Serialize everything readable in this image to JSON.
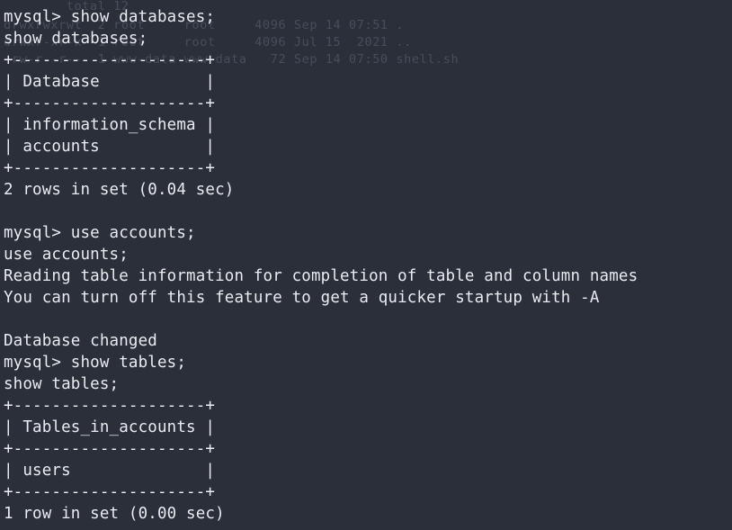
{
  "terminal": {
    "background_color": "#2b2f3a",
    "foreground_color": "#e9ebf1",
    "ghost_color": "#474d5b",
    "ghost_output": {
      "description": "faded remnants of a previous directory listing",
      "lines": [
        "        total 12",
        "drwxrwxrwt  2 root     root     4096 Sep 14 07:51 .",
        "drwxr-xr-x  1 root     root     4096 Jul 15  2021 ..",
        "-rw-r--r--  1 www-data www-data   72 Sep 14 07:50 shell.sh"
      ]
    },
    "session": {
      "prompt": "mysql>",
      "lines": [
        {
          "kind": "prompt",
          "text": "mysql> show databases;"
        },
        {
          "kind": "echo",
          "text": "show databases;"
        },
        {
          "kind": "rule",
          "text": "+--------------------+"
        },
        {
          "kind": "row",
          "text": "| Database           |"
        },
        {
          "kind": "rule",
          "text": "+--------------------+"
        },
        {
          "kind": "row",
          "text": "| information_schema |"
        },
        {
          "kind": "row",
          "text": "| accounts           |"
        },
        {
          "kind": "rule",
          "text": "+--------------------+"
        },
        {
          "kind": "status",
          "text": "2 rows in set (0.04 sec)"
        },
        {
          "kind": "blank",
          "text": " "
        },
        {
          "kind": "prompt",
          "text": "mysql> use accounts;"
        },
        {
          "kind": "echo",
          "text": "use accounts;"
        },
        {
          "kind": "notice",
          "text": "Reading table information for completion of table and column names"
        },
        {
          "kind": "notice",
          "text": "You can turn off this feature to get a quicker startup with -A"
        },
        {
          "kind": "blank",
          "text": " "
        },
        {
          "kind": "status",
          "text": "Database changed"
        },
        {
          "kind": "prompt",
          "text": "mysql> show tables;"
        },
        {
          "kind": "echo",
          "text": "show tables;"
        },
        {
          "kind": "rule",
          "text": "+--------------------+"
        },
        {
          "kind": "row",
          "text": "| Tables_in_accounts |"
        },
        {
          "kind": "rule",
          "text": "+--------------------+"
        },
        {
          "kind": "row",
          "text": "| users              |"
        },
        {
          "kind": "rule",
          "text": "+--------------------+"
        },
        {
          "kind": "status",
          "text": "1 row in set (0.00 sec)"
        }
      ]
    },
    "result_sets": [
      {
        "query": "show databases;",
        "columns": [
          "Database"
        ],
        "rows": [
          [
            "information_schema"
          ],
          [
            "accounts"
          ]
        ],
        "row_count_text": "2 rows in set (0.04 sec)",
        "row_count": 2,
        "elapsed_sec": "0.04"
      },
      {
        "query": "show tables;",
        "columns": [
          "Tables_in_accounts"
        ],
        "rows": [
          [
            "users"
          ]
        ],
        "row_count_text": "1 row in set (0.00 sec)",
        "row_count": 1,
        "elapsed_sec": "0.00"
      }
    ],
    "messages": [
      "Reading table information for completion of table and column names",
      "You can turn off this feature to get a quicker startup with -A",
      "Database changed"
    ],
    "current_database": "accounts"
  }
}
